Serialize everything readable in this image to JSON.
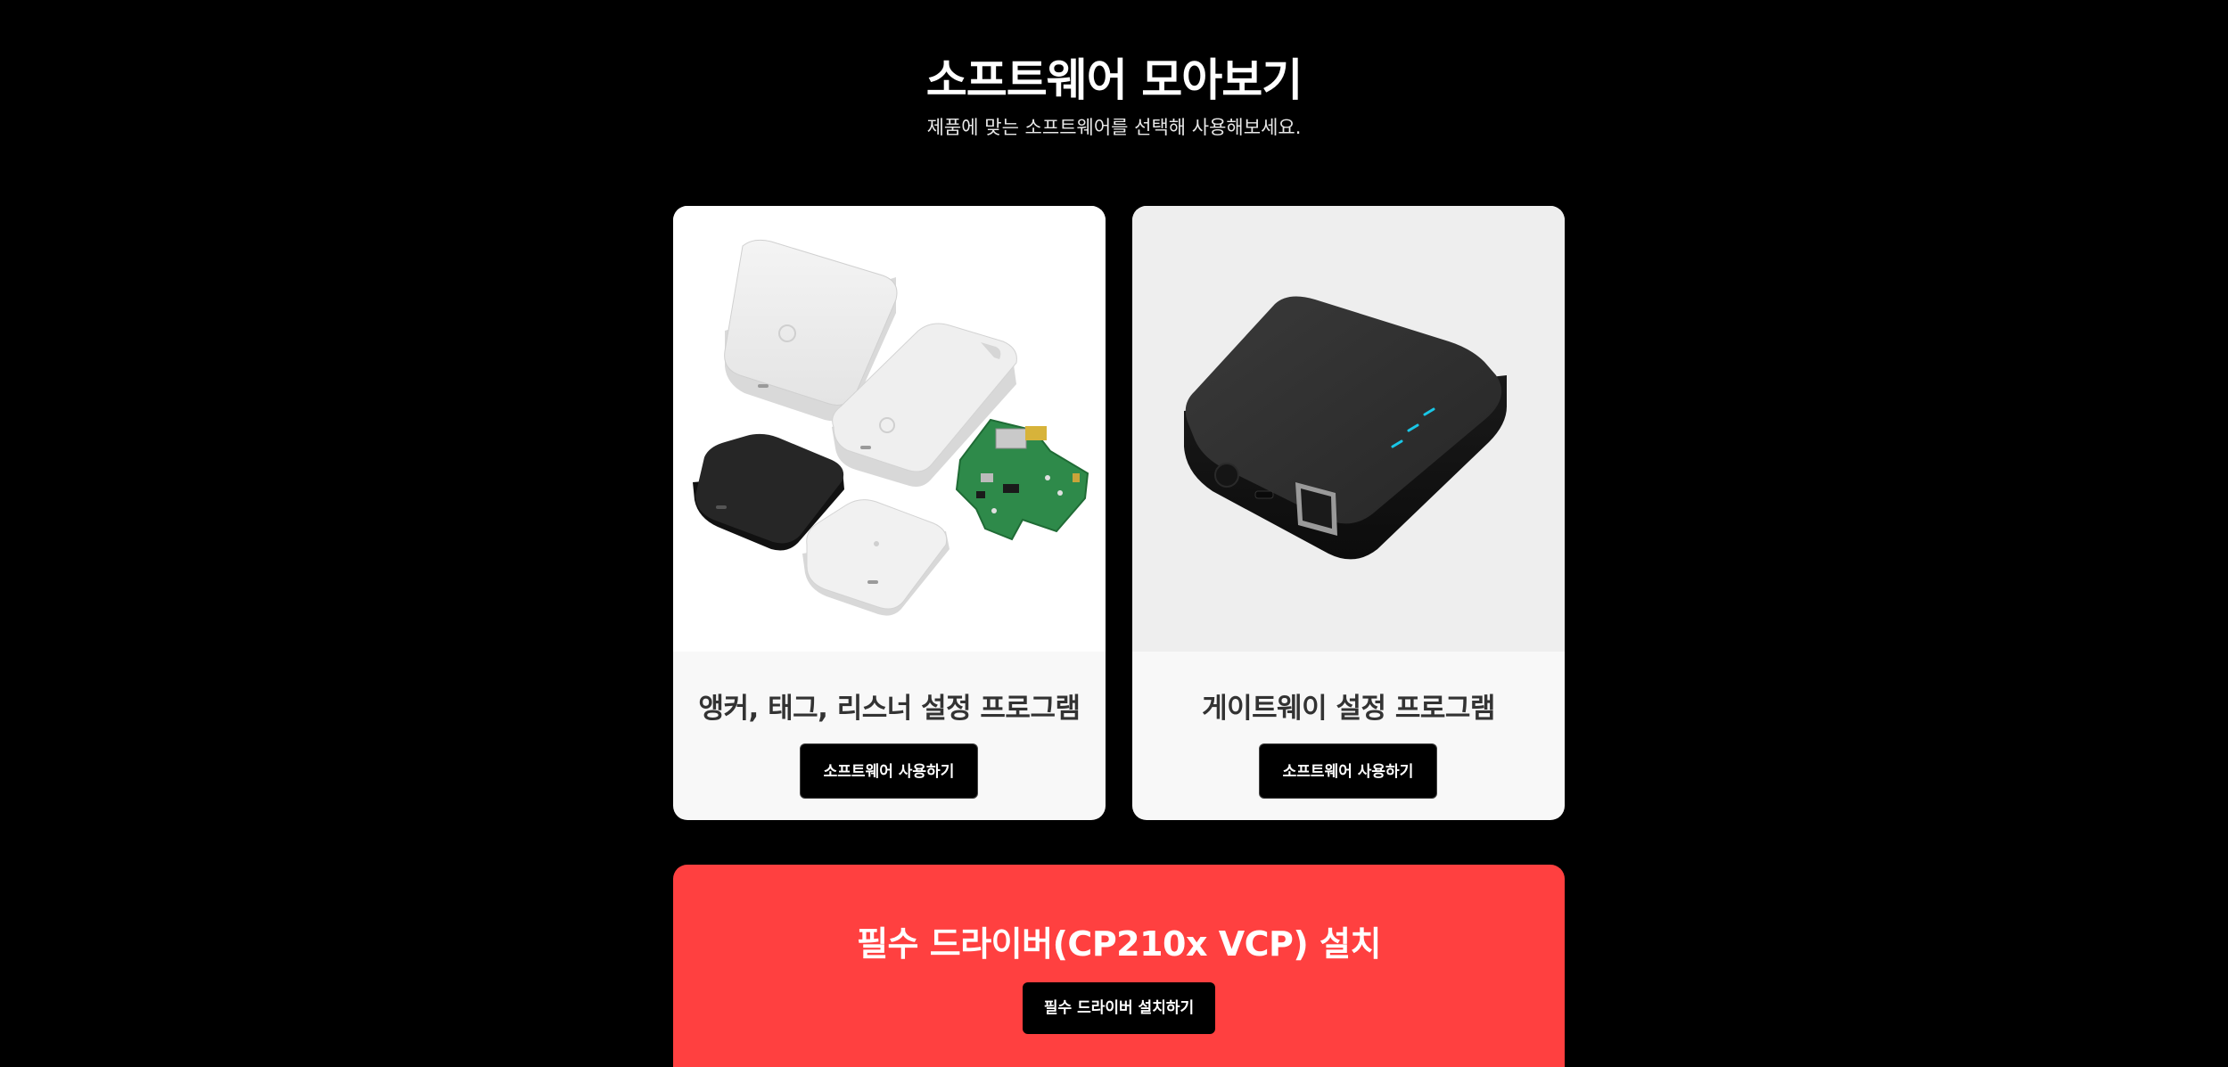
{
  "header": {
    "title": "소프트웨어 모아보기",
    "subtitle": "제품에 맞는 소프트웨어를 선택해 사용해보세요."
  },
  "cards": [
    {
      "title": "앵커, 태그, 리스너 설정 프로그램",
      "button_label": "소프트웨어 사용하기",
      "image": "anchor-tag-listener-devices"
    },
    {
      "title": "게이트웨이 설정 프로그램",
      "button_label": "소프트웨어 사용하기",
      "image": "gateway-device"
    }
  ],
  "driver": {
    "title": "필수 드라이버(CP210x VCP) 설치",
    "button_label": "필수 드라이버 설치하기",
    "accent_color": "#ff4040"
  },
  "colors": {
    "background": "#000000",
    "card_background": "#f8f8f8",
    "button_background": "#000000",
    "led": "#19c6e6"
  }
}
